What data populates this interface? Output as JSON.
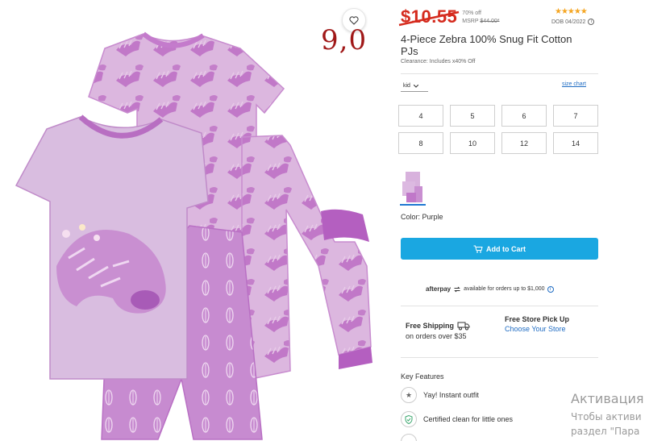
{
  "overlay": {
    "number": "9,0"
  },
  "product": {
    "price": "$10.55",
    "discount_line": "70% off",
    "msrp_label": "MSRP",
    "msrp_value": "$44.00*",
    "rating_stars": "★★★★★",
    "dob": "DOB 04/2022",
    "title": "4-Piece Zebra 100% Snug Fit Cotton PJs",
    "clearance": "Clearance: Includes x40% Off",
    "size_type": "kid",
    "size_chart": "size chart",
    "sizes": [
      "4",
      "5",
      "6",
      "7",
      "8",
      "10",
      "12",
      "14"
    ],
    "color_label": "Color: Purple",
    "add_to_cart": "Add to Cart"
  },
  "afterpay": {
    "brand": "afterpay",
    "text": "available for orders up to $1,000"
  },
  "shipping": {
    "free_shipping_title": "Free Shipping",
    "free_shipping_sub": "on orders over $35",
    "pickup_title": "Free Store Pick Up",
    "pickup_link": "Choose Your Store"
  },
  "features": {
    "title": "Key Features",
    "items": [
      "Yay! Instant outfit",
      "Certified clean for little ones"
    ]
  },
  "watermark": {
    "line1": "Активация",
    "line2": "Чтобы активи",
    "line3": "раздел \"Пара"
  },
  "colors": {
    "price_red": "#d52b1e",
    "cart_blue": "#1aa7e1",
    "link_blue": "#1f6cc3",
    "garment_lilac": "#d9b3dd",
    "garment_magenta": "#b45fc0"
  }
}
